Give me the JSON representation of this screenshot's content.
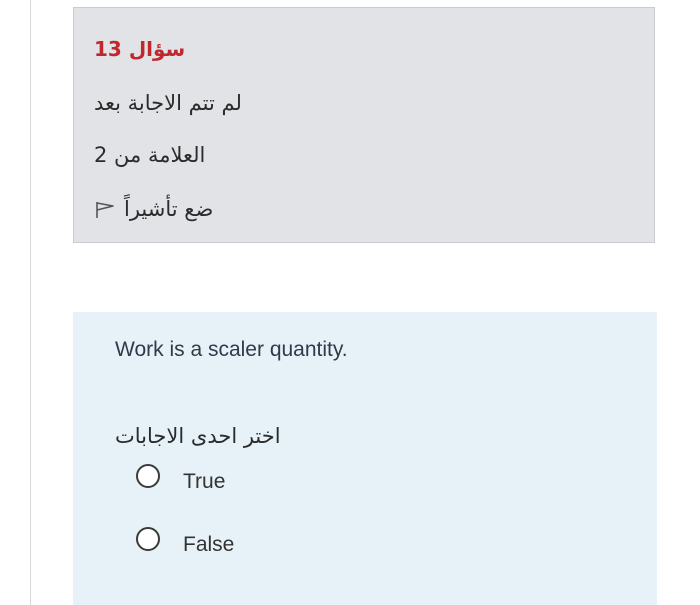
{
  "info": {
    "question_word": "سؤال",
    "question_number": "13",
    "status": "لم تتم الاجابة بعد",
    "marks": "العلامة من 2",
    "flag_label": "ضع تأشيراً",
    "flag_icon": "flag-outline-icon"
  },
  "question": {
    "text": "Work is a scaler quantity.",
    "prompt": "اختر احدى الاجابات",
    "options": [
      {
        "label": "True",
        "selected": false
      },
      {
        "label": "False",
        "selected": false
      }
    ]
  },
  "colors": {
    "info_bg": "#e1e3e6",
    "question_bg": "#e6f2f7",
    "accent_red": "#c1272d"
  }
}
